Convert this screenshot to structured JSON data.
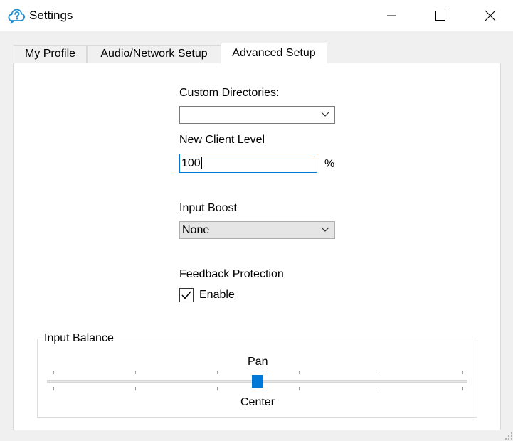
{
  "window": {
    "title": "Settings",
    "icon": "cloud-icon",
    "controls": [
      "minimize-icon",
      "maximize-icon",
      "close-icon"
    ]
  },
  "tabs": [
    {
      "label": "My Profile",
      "selected": false
    },
    {
      "label": "Audio/Network Setup",
      "selected": false
    },
    {
      "label": "Advanced Setup",
      "selected": true
    }
  ],
  "advanced": {
    "custom_directories": {
      "label": "Custom Directories:",
      "value": ""
    },
    "new_client_level": {
      "label": "New Client Level",
      "value": "100",
      "unit": "%"
    },
    "input_boost": {
      "label": "Input Boost",
      "value": "None"
    },
    "feedback_protection": {
      "label": "Feedback Protection",
      "checkbox_label": "Enable",
      "checked": true
    },
    "input_balance": {
      "group_label": "Input Balance",
      "slider_title": "Pan",
      "slider_value_label": "Center",
      "position_fraction": 0.5,
      "tick_count": 6
    }
  },
  "colors": {
    "accent": "#0078d7",
    "titlebar_bg": "#ffffff",
    "window_bg": "#f0f0f0",
    "panel_bg": "#ffffff"
  }
}
